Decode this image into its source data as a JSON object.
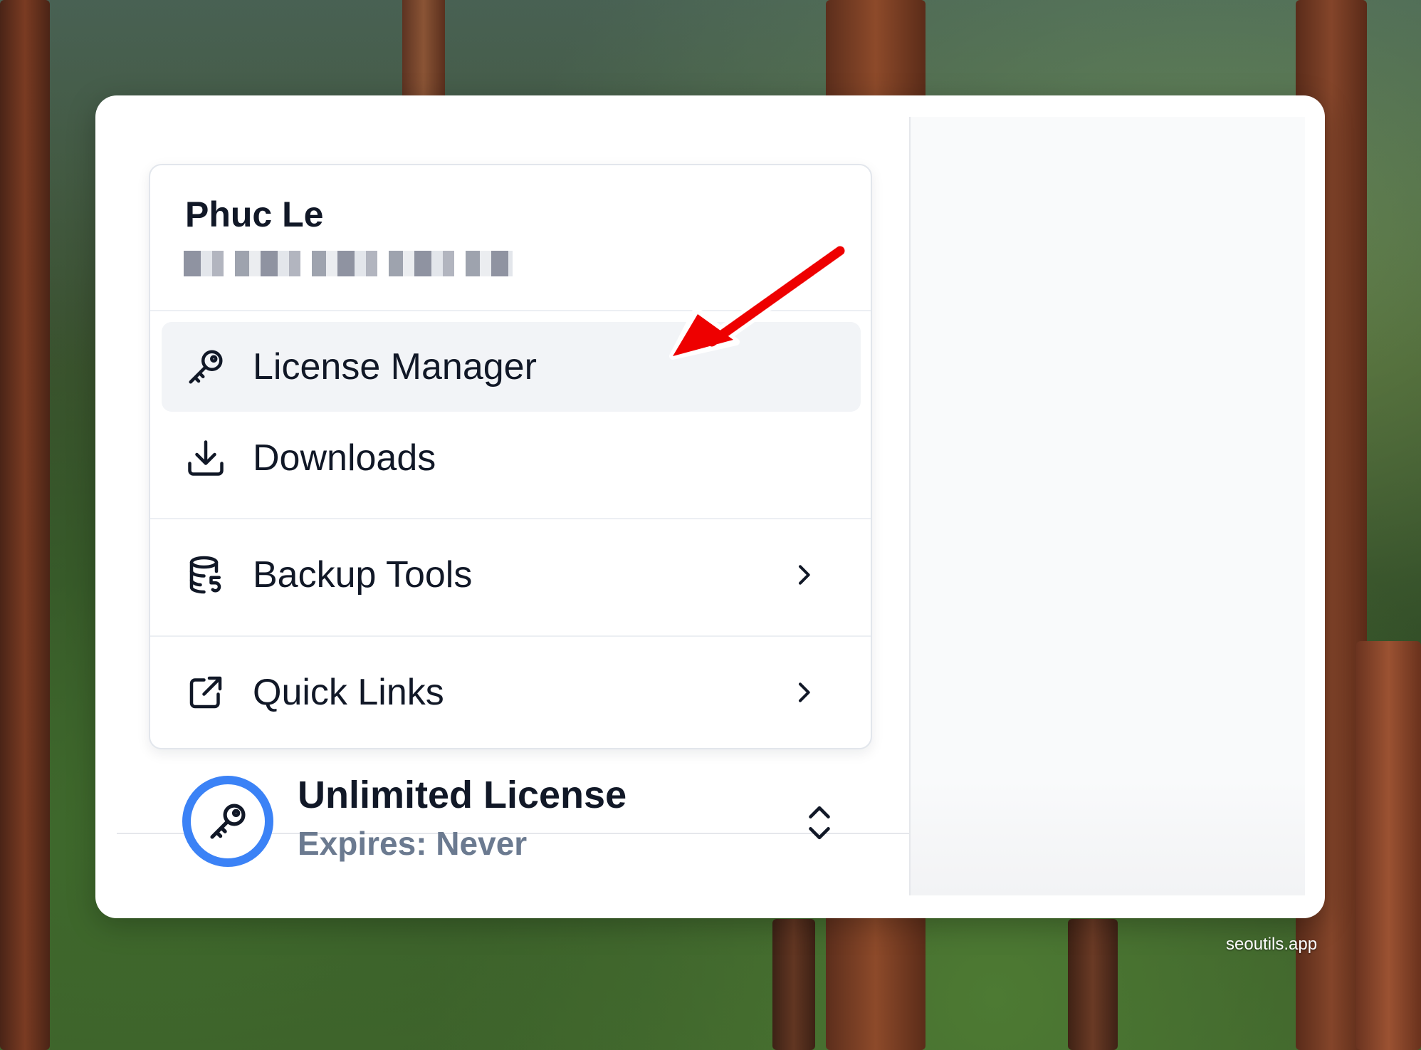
{
  "user": {
    "name": "Phuc Le"
  },
  "menu": {
    "items": [
      {
        "label": "License Manager",
        "icon": "key-icon",
        "active": true
      },
      {
        "label": "Downloads",
        "icon": "download-icon"
      },
      {
        "label": "Backup Tools",
        "icon": "database-restore-icon",
        "submenu": true
      },
      {
        "label": "Quick Links",
        "icon": "external-link-icon",
        "submenu": true
      }
    ]
  },
  "license": {
    "title": "Unlimited License",
    "subtitle": "Expires: Never",
    "accent_color": "#3b82f6"
  },
  "watermark": "seoutils.app",
  "colors": {
    "annotation_arrow": "#ee0000",
    "active_item_bg": "#f2f4f7"
  }
}
